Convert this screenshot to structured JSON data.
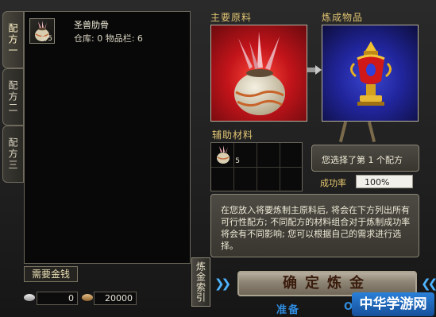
{
  "tabs": [
    {
      "label": "配方一",
      "active": true
    },
    {
      "label": "配方二",
      "active": false
    },
    {
      "label": "配方三",
      "active": false
    }
  ],
  "recipe_list": {
    "items": [
      {
        "icon": "pot-icon",
        "count": "5/5",
        "name": "圣兽肋骨",
        "meta": "仓库: 0    物品栏: 6"
      }
    ]
  },
  "money": {
    "label": "需要金钱",
    "silver": "0",
    "bronze": "20000"
  },
  "index_button": "炼金索引",
  "sections": {
    "main_material": "主要原料",
    "product": "炼成物品",
    "aux_material": "辅助材料"
  },
  "aux_slots": [
    {
      "icon": "pot-icon",
      "count": "5"
    }
  ],
  "choice": {
    "text": "您选择了第 1 个配方"
  },
  "success_rate": {
    "label": "成功率",
    "value": "100%"
  },
  "description": "在您放入将要炼制主原料后, 将会在下方列出所有可行性配方; 不同配方的材料组合对于炼制成功率将会有不同影响; 您可以根据自己的需求进行选择。",
  "confirm_button": "确定炼金",
  "footer": {
    "ready": "准备",
    "ok": "OK"
  },
  "watermark": "中华学游网",
  "colors": {
    "title_gold": "#e0c472",
    "main_box_red": "#c2141a",
    "product_box_blue": "#21259c",
    "accent_blue": "#2f8de2"
  }
}
